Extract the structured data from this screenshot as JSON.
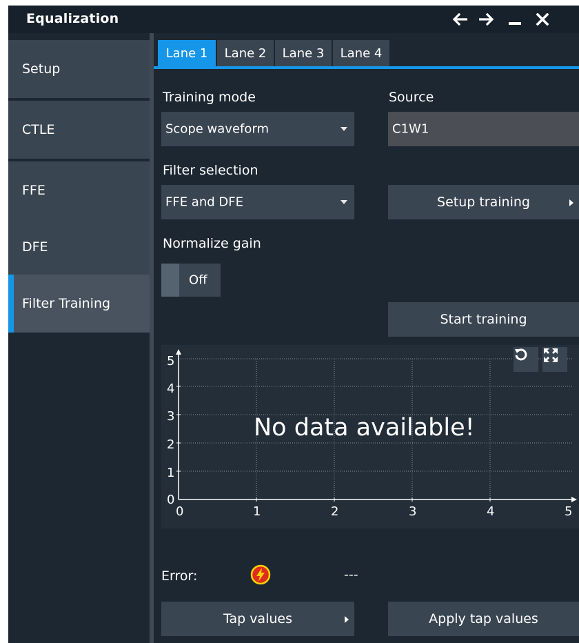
{
  "window": {
    "title": "Equalization",
    "controls": [
      "back-arrow-icon",
      "forward-arrow-icon",
      "minimize-icon",
      "close-icon"
    ]
  },
  "sidebar": {
    "items": [
      {
        "label": "Setup"
      },
      {
        "label": "CTLE"
      },
      {
        "label": "FFE"
      },
      {
        "label": "DFE"
      },
      {
        "label": "Filter Training",
        "active": true
      }
    ]
  },
  "tabs": [
    {
      "label": "Lane 1",
      "active": true
    },
    {
      "label": "Lane 2"
    },
    {
      "label": "Lane 3"
    },
    {
      "label": "Lane 4"
    }
  ],
  "form": {
    "training_mode_label": "Training mode",
    "training_mode_value": "Scope waveform",
    "source_label": "Source",
    "source_value": "C1W1",
    "filter_selection_label": "Filter selection",
    "filter_selection_value": "FFE and DFE",
    "setup_training_label": "Setup training",
    "normalize_gain_label": "Normalize gain",
    "normalize_gain_value": "Off",
    "start_training_label": "Start training"
  },
  "plot": {
    "message": "No data available!",
    "x_ticks": [
      "0",
      "1",
      "2",
      "3",
      "4",
      "5"
    ],
    "y_ticks": [
      "0",
      "1",
      "2",
      "3",
      "4",
      "5"
    ],
    "buttons": [
      "refresh-icon",
      "fullscreen-icon"
    ]
  },
  "status": {
    "error_label": "Error:",
    "error_value": "---",
    "error_icon": "lightning-error-icon"
  },
  "footer": {
    "tap_values_label": "Tap values",
    "apply_tap_values_label": "Apply tap values"
  },
  "colors": {
    "accent": "#1596e8",
    "background": "#1d2732",
    "control": "#3a4552",
    "error_icon_fill": "#e02b1f",
    "error_icon_bolt": "#ffd200"
  }
}
